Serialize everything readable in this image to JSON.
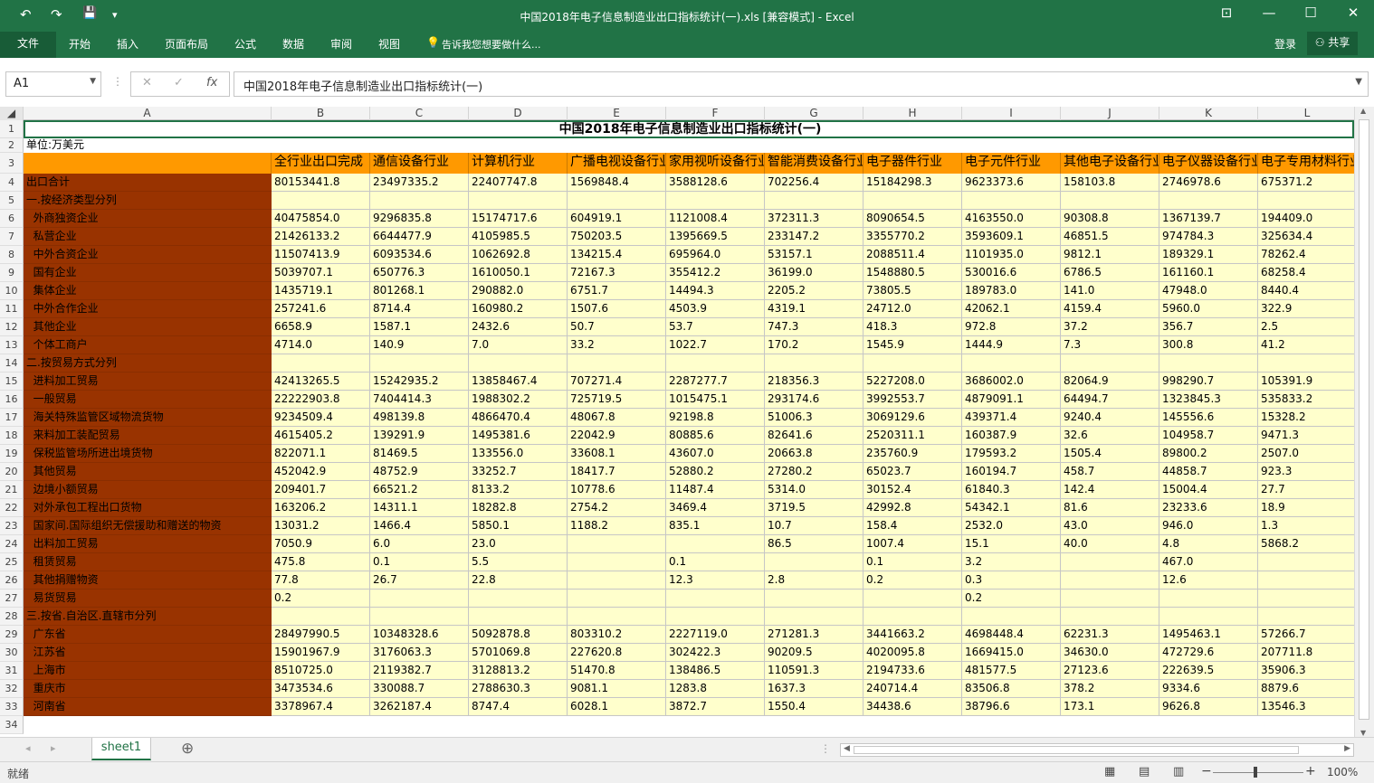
{
  "window": {
    "title": "中国2018年电子信息制造业出口指标统计(一).xls  [兼容模式] - Excel",
    "quick_access": {
      "undo": "↶",
      "redo": "↷",
      "save": "💾",
      "customize": "▾"
    },
    "controls": {
      "ribbon_display": "⊡",
      "minimize": "—",
      "maximize": "☐",
      "close": "✕"
    }
  },
  "ribbon": {
    "tabs": [
      "文件",
      "开始",
      "插入",
      "页面布局",
      "公式",
      "数据",
      "审阅",
      "视图"
    ],
    "tell_me": "告诉我您想要做什么...",
    "signin": "登录",
    "share": "共享"
  },
  "formula_bar": {
    "name_box": "A1",
    "cancel": "✕",
    "enter": "✓",
    "fx": "fx",
    "content": "中国2018年电子信息制造业出口指标统计(一)"
  },
  "sheet": {
    "title": "中国2018年电子信息制造业出口指标统计(一)",
    "unit": "单位:万美元",
    "column_letters": [
      "A",
      "B",
      "C",
      "D",
      "E",
      "F",
      "G",
      "H",
      "I",
      "J",
      "K",
      "L"
    ],
    "header_row": [
      "",
      "全行业出口完成",
      "通信设备行业",
      "计算机行业",
      "广播电视设备行业",
      "家用视听设备行业",
      "智能消费设备行业",
      "电子器件行业",
      "电子元件行业",
      "其他电子设备行业",
      "电子仪器设备行业",
      "电子专用材料行业"
    ],
    "rows": [
      {
        "n": "4",
        "cells": [
          "出口合计",
          "80153441.8",
          "23497335.2",
          "22407747.8",
          "1569848.4",
          "3588128.6",
          "702256.4",
          "15184298.3",
          "9623373.6",
          "158103.8",
          "2746978.6",
          "675371.2"
        ]
      },
      {
        "n": "5",
        "cells": [
          "一.按经济类型分列",
          "",
          "",
          "",
          "",
          "",
          "",
          "",
          "",
          "",
          "",
          ""
        ]
      },
      {
        "n": "6",
        "cells": [
          "  外商独资企业",
          "40475854.0",
          "9296835.8",
          "15174717.6",
          "604919.1",
          "1121008.4",
          "372311.3",
          "8090654.5",
          "4163550.0",
          "90308.8",
          "1367139.7",
          "194409.0"
        ]
      },
      {
        "n": "7",
        "cells": [
          "  私营企业",
          "21426133.2",
          "6644477.9",
          "4105985.5",
          "750203.5",
          "1395669.5",
          "233147.2",
          "3355770.2",
          "3593609.1",
          "46851.5",
          "974784.3",
          "325634.4"
        ]
      },
      {
        "n": "8",
        "cells": [
          "  中外合资企业",
          "11507413.9",
          "6093534.6",
          "1062692.8",
          "134215.4",
          "695964.0",
          "53157.1",
          "2088511.4",
          "1101935.0",
          "9812.1",
          "189329.1",
          "78262.4"
        ]
      },
      {
        "n": "9",
        "cells": [
          "  国有企业",
          "5039707.1",
          "650776.3",
          "1610050.1",
          "72167.3",
          "355412.2",
          "36199.0",
          "1548880.5",
          "530016.6",
          "6786.5",
          "161160.1",
          "68258.4"
        ]
      },
      {
        "n": "10",
        "cells": [
          "  集体企业",
          "1435719.1",
          "801268.1",
          "290882.0",
          "6751.7",
          "14494.3",
          "2205.2",
          "73805.5",
          "189783.0",
          "141.0",
          "47948.0",
          "8440.4"
        ]
      },
      {
        "n": "11",
        "cells": [
          "  中外合作企业",
          "257241.6",
          "8714.4",
          "160980.2",
          "1507.6",
          "4503.9",
          "4319.1",
          "24712.0",
          "42062.1",
          "4159.4",
          "5960.0",
          "322.9"
        ]
      },
      {
        "n": "12",
        "cells": [
          "  其他企业",
          "6658.9",
          "1587.1",
          "2432.6",
          "50.7",
          "53.7",
          "747.3",
          "418.3",
          "972.8",
          "37.2",
          "356.7",
          "2.5"
        ]
      },
      {
        "n": "13",
        "cells": [
          "  个体工商户",
          "4714.0",
          "140.9",
          "7.0",
          "33.2",
          "1022.7",
          "170.2",
          "1545.9",
          "1444.9",
          "7.3",
          "300.8",
          "41.2"
        ]
      },
      {
        "n": "14",
        "cells": [
          "二.按贸易方式分列",
          "",
          "",
          "",
          "",
          "",
          "",
          "",
          "",
          "",
          "",
          ""
        ]
      },
      {
        "n": "15",
        "cells": [
          "  进料加工贸易",
          "42413265.5",
          "15242935.2",
          "13858467.4",
          "707271.4",
          "2287277.7",
          "218356.3",
          "5227208.0",
          "3686002.0",
          "82064.9",
          "998290.7",
          "105391.9"
        ]
      },
      {
        "n": "16",
        "cells": [
          "  一般贸易",
          "22222903.8",
          "7404414.3",
          "1988302.2",
          "725719.5",
          "1015475.1",
          "293174.6",
          "3992553.7",
          "4879091.1",
          "64494.7",
          "1323845.3",
          "535833.2"
        ]
      },
      {
        "n": "17",
        "cells": [
          "  海关特殊监管区域物流货物",
          "9234509.4",
          "498139.8",
          "4866470.4",
          "48067.8",
          "92198.8",
          "51006.3",
          "3069129.6",
          "439371.4",
          "9240.4",
          "145556.6",
          "15328.2"
        ]
      },
      {
        "n": "18",
        "cells": [
          "  来料加工装配贸易",
          "4615405.2",
          "139291.9",
          "1495381.6",
          "22042.9",
          "80885.6",
          "82641.6",
          "2520311.1",
          "160387.9",
          "32.6",
          "104958.7",
          "9471.3"
        ]
      },
      {
        "n": "19",
        "cells": [
          "  保税监管场所进出境货物",
          "822071.1",
          "81469.5",
          "133556.0",
          "33608.1",
          "43607.0",
          "20663.8",
          "235760.9",
          "179593.2",
          "1505.4",
          "89800.2",
          "2507.0"
        ]
      },
      {
        "n": "20",
        "cells": [
          "  其他贸易",
          "452042.9",
          "48752.9",
          "33252.7",
          "18417.7",
          "52880.2",
          "27280.2",
          "65023.7",
          "160194.7",
          "458.7",
          "44858.7",
          "923.3"
        ]
      },
      {
        "n": "21",
        "cells": [
          "  边境小额贸易",
          "209401.7",
          "66521.2",
          "8133.2",
          "10778.6",
          "11487.4",
          "5314.0",
          "30152.4",
          "61840.3",
          "142.4",
          "15004.4",
          "27.7"
        ]
      },
      {
        "n": "22",
        "cells": [
          "  对外承包工程出口货物",
          "163206.2",
          "14311.1",
          "18282.8",
          "2754.2",
          "3469.4",
          "3719.5",
          "42992.8",
          "54342.1",
          "81.6",
          "23233.6",
          "18.9"
        ]
      },
      {
        "n": "23",
        "cells": [
          "  国家间.国际组织无偿援助和赠送的物资",
          "13031.2",
          "1466.4",
          "5850.1",
          "1188.2",
          "835.1",
          "10.7",
          "158.4",
          "2532.0",
          "43.0",
          "946.0",
          "1.3"
        ]
      },
      {
        "n": "24",
        "cells": [
          "  出料加工贸易",
          "7050.9",
          "6.0",
          "23.0",
          "",
          "",
          "86.5",
          "1007.4",
          "15.1",
          "40.0",
          "4.8",
          "5868.2"
        ]
      },
      {
        "n": "25",
        "cells": [
          "  租赁贸易",
          "475.8",
          "0.1",
          "5.5",
          "",
          "0.1",
          "",
          "0.1",
          "3.2",
          "",
          "467.0",
          ""
        ]
      },
      {
        "n": "26",
        "cells": [
          "  其他捐赠物资",
          "77.8",
          "26.7",
          "22.8",
          "",
          "12.3",
          "2.8",
          "0.2",
          "0.3",
          "",
          "12.6",
          ""
        ]
      },
      {
        "n": "27",
        "cells": [
          "  易货贸易",
          "0.2",
          "",
          "",
          "",
          "",
          "",
          "",
          "0.2",
          "",
          "",
          ""
        ]
      },
      {
        "n": "28",
        "cells": [
          "三.按省.自治区.直辖市分列",
          "",
          "",
          "",
          "",
          "",
          "",
          "",
          "",
          "",
          "",
          ""
        ]
      },
      {
        "n": "29",
        "cells": [
          "  广东省",
          "28497990.5",
          "10348328.6",
          "5092878.8",
          "803310.2",
          "2227119.0",
          "271281.3",
          "3441663.2",
          "4698448.4",
          "62231.3",
          "1495463.1",
          "57266.7"
        ]
      },
      {
        "n": "30",
        "cells": [
          "  江苏省",
          "15901967.9",
          "3176063.3",
          "5701069.8",
          "227620.8",
          "302422.3",
          "90209.5",
          "4020095.8",
          "1669415.0",
          "34630.0",
          "472729.6",
          "207711.8"
        ]
      },
      {
        "n": "31",
        "cells": [
          "  上海市",
          "8510725.0",
          "2119382.7",
          "3128813.2",
          "51470.8",
          "138486.5",
          "110591.3",
          "2194733.6",
          "481577.5",
          "27123.6",
          "222639.5",
          "35906.3"
        ]
      },
      {
        "n": "32",
        "cells": [
          "  重庆市",
          "3473534.6",
          "330088.7",
          "2788630.3",
          "9081.1",
          "1283.8",
          "1637.3",
          "240714.4",
          "83506.8",
          "378.2",
          "9334.6",
          "8879.6"
        ]
      },
      {
        "n": "33",
        "cells": [
          "  河南省",
          "3378967.4",
          "3262187.4",
          "8747.4",
          "6028.1",
          "3872.7",
          "1550.4",
          "34438.6",
          "38796.6",
          "173.1",
          "9626.8",
          "13546.3"
        ]
      }
    ],
    "last_row": "34"
  },
  "sheet_tabs": {
    "active": "sheet1",
    "add": "⊕",
    "prev": "◂",
    "next": "▸"
  },
  "statusbar": {
    "ready": "就绪",
    "zoom": "100%",
    "zoom_minus": "−",
    "zoom_plus": "+"
  },
  "colors": {
    "excel_green": "#217346",
    "label_bg": "#993300",
    "header_bg": "#ff9900",
    "data_bg": "#ffffcc"
  }
}
